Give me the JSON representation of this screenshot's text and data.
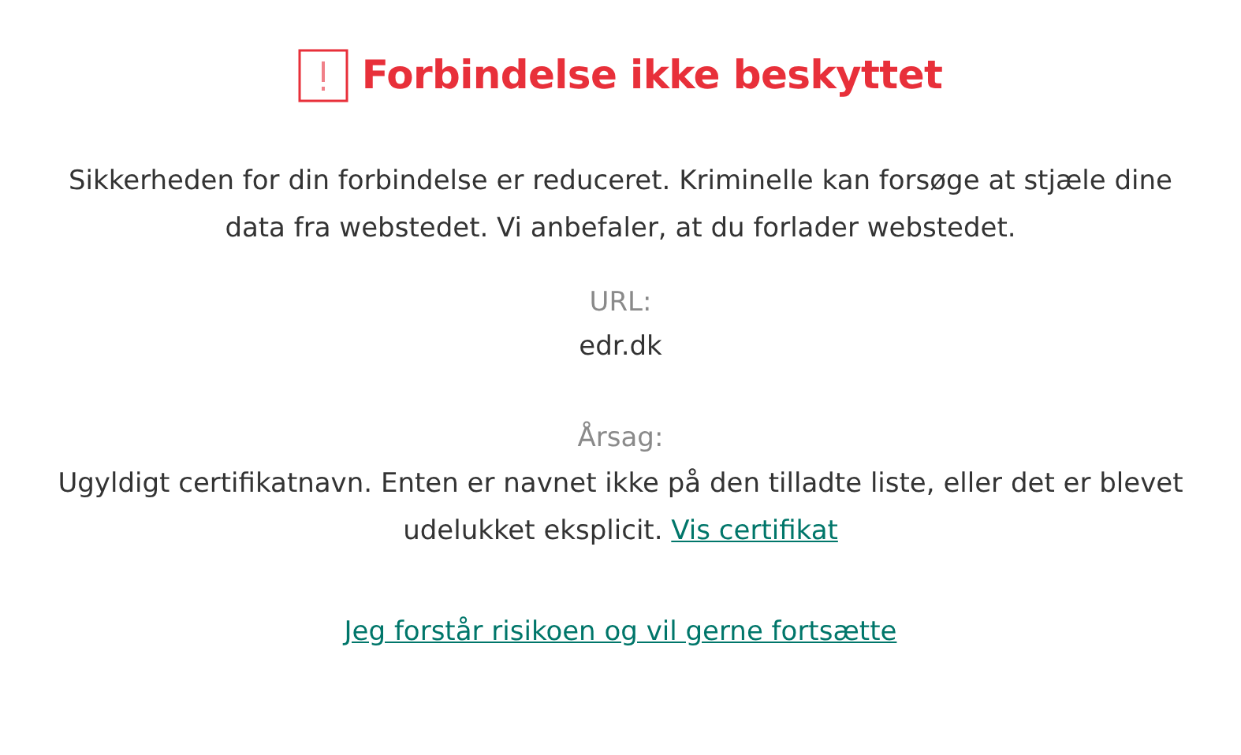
{
  "title": "Forbindelse ikke beskyttet",
  "message": "Sikkerheden for din forbindelse er reduceret. Kriminelle kan forsøge at stjæle dine data fra webstedet. Vi anbefaler, at du forlader webstedet.",
  "url": {
    "label": "URL:",
    "value": "edr.dk"
  },
  "reason": {
    "label": "Årsag:",
    "text": "Ugyldigt certifikatnavn. Enten er navnet ikke på den tilladte liste, eller det er blevet udelukket eksplicit.",
    "link": "Vis certifikat"
  },
  "continue_link": "Jeg forstår risikoen og vil gerne fortsætte"
}
